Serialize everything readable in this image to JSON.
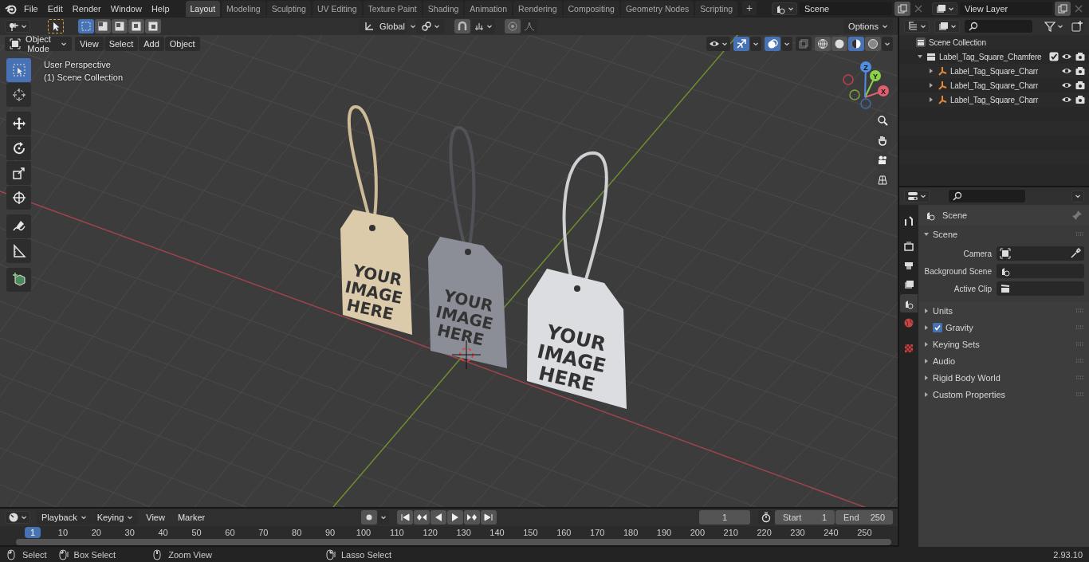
{
  "menu": [
    "File",
    "Edit",
    "Render",
    "Window",
    "Help"
  ],
  "workspaces": [
    {
      "label": "Layout",
      "selected": true
    },
    {
      "label": "Modeling",
      "selected": false
    },
    {
      "label": "Sculpting",
      "selected": false
    },
    {
      "label": "UV Editing",
      "selected": false
    },
    {
      "label": "Texture Paint",
      "selected": false
    },
    {
      "label": "Shading",
      "selected": false
    },
    {
      "label": "Animation",
      "selected": false
    },
    {
      "label": "Rendering",
      "selected": false
    },
    {
      "label": "Compositing",
      "selected": false
    },
    {
      "label": "Geometry Nodes",
      "selected": false
    },
    {
      "label": "Scripting",
      "selected": false
    }
  ],
  "add_workspace": "+",
  "scene_field": {
    "value": "Scene"
  },
  "view_layer_field": {
    "value": "View Layer"
  },
  "tool_settings": {
    "select_modes": [
      {
        "selected": true
      },
      {
        "selected": false
      },
      {
        "selected": false
      },
      {
        "selected": false
      },
      {
        "selected": false
      }
    ],
    "orientation": "Global",
    "options": "Options"
  },
  "viewport_header": {
    "mode": "Object Mode",
    "menus": [
      "View",
      "Select",
      "Add",
      "Object"
    ],
    "toggles": [
      {
        "kind": "gizmo",
        "on": true
      },
      {
        "kind": "overlay",
        "on": true
      },
      {
        "kind": "xray",
        "on": false
      }
    ],
    "shading": [
      {
        "kind": "wireframe",
        "selected": false
      },
      {
        "kind": "solid",
        "selected": false
      },
      {
        "kind": "material",
        "selected": true
      },
      {
        "kind": "rendered",
        "selected": false
      }
    ]
  },
  "toolbar": [
    {
      "kind": "select",
      "selected": true
    },
    {
      "kind": "cursor",
      "selected": false
    },
    {
      "kind": "move",
      "selected": false
    },
    {
      "kind": "rotate",
      "selected": false
    },
    {
      "kind": "scale",
      "selected": false
    },
    {
      "kind": "transform",
      "selected": false
    },
    {
      "kind": "annotate",
      "selected": false
    },
    {
      "kind": "measure",
      "selected": false
    },
    {
      "kind": "add_cube",
      "selected": false
    }
  ],
  "viewport": {
    "view_name": "User Perspective",
    "collection": "(1) Scene Collection",
    "gizmo_axes": [
      "X",
      "Y",
      "Z"
    ],
    "tags": [
      {
        "color": "#dccbaa",
        "lines": [
          "YOUR",
          "IMAGE",
          "HERE"
        ]
      },
      {
        "color": "#8b8e96",
        "lines": [
          "YOUR",
          "IMAGE",
          "HERE"
        ]
      },
      {
        "color": "#dcdde1",
        "lines": [
          "YOUR",
          "IMAGE",
          "HERE"
        ]
      }
    ]
  },
  "outliner": {
    "root": "Scene Collection",
    "children": [
      {
        "name": "Label_Tag_Square_Chamfere",
        "expanded": true,
        "checked": true,
        "children": [
          {
            "name": "Label_Tag_Square_Charr",
            "expanded": false
          },
          {
            "name": "Label_Tag_Square_Charr",
            "expanded": false
          },
          {
            "name": "Label_Tag_Square_Charr",
            "expanded": false
          }
        ]
      }
    ]
  },
  "properties": {
    "tabs": [
      {
        "kind": "tool",
        "selected": false
      },
      {
        "kind": "render",
        "selected": false
      },
      {
        "kind": "output",
        "selected": false
      },
      {
        "kind": "view_layer",
        "selected": false
      },
      {
        "kind": "scene",
        "selected": true
      },
      {
        "kind": "world",
        "selected": false
      },
      {
        "kind": "texture",
        "selected": false
      }
    ],
    "context": "Scene",
    "panel": {
      "title": "Scene",
      "expanded": true,
      "fields": [
        {
          "label": "Camera",
          "kind": "object"
        },
        {
          "label": "Background Scene",
          "kind": "scene"
        },
        {
          "label": "Active Clip",
          "kind": "clip"
        }
      ]
    },
    "sections": [
      {
        "title": "Units",
        "expanded": false
      },
      {
        "title": "Gravity",
        "expanded": false,
        "checkbox": {
          "checked": true
        }
      },
      {
        "title": "Keying Sets",
        "expanded": false
      },
      {
        "title": "Audio",
        "expanded": false
      },
      {
        "title": "Rigid Body World",
        "expanded": false
      },
      {
        "title": "Custom Properties",
        "expanded": false
      }
    ]
  },
  "timeline": {
    "menus": [
      "Playback",
      "Keying",
      "View",
      "Marker"
    ],
    "current_frame": "1",
    "start_label": "Start",
    "start": "1",
    "end_label": "End",
    "end": "250",
    "ruler": [
      {
        "label": "1",
        "selected": true
      },
      {
        "label": "10",
        "selected": false
      },
      {
        "label": "20",
        "selected": false
      },
      {
        "label": "30",
        "selected": false
      },
      {
        "label": "40",
        "selected": false
      },
      {
        "label": "50",
        "selected": false
      },
      {
        "label": "60",
        "selected": false
      },
      {
        "label": "70",
        "selected": false
      },
      {
        "label": "80",
        "selected": false
      },
      {
        "label": "90",
        "selected": false
      },
      {
        "label": "100",
        "selected": false
      },
      {
        "label": "110",
        "selected": false
      },
      {
        "label": "120",
        "selected": false
      },
      {
        "label": "130",
        "selected": false
      },
      {
        "label": "140",
        "selected": false
      },
      {
        "label": "150",
        "selected": false
      },
      {
        "label": "160",
        "selected": false
      },
      {
        "label": "170",
        "selected": false
      },
      {
        "label": "180",
        "selected": false
      },
      {
        "label": "190",
        "selected": false
      },
      {
        "label": "200",
        "selected": false
      },
      {
        "label": "210",
        "selected": false
      },
      {
        "label": "220",
        "selected": false
      },
      {
        "label": "230",
        "selected": false
      },
      {
        "label": "240",
        "selected": false
      },
      {
        "label": "250",
        "selected": false
      }
    ]
  },
  "status_bar": {
    "hints": [
      {
        "kind": "left",
        "label": "Select"
      },
      {
        "kind": "left_drag",
        "label": "Box Select"
      },
      {
        "kind": "middle",
        "label": "Zoom View"
      },
      {
        "kind": "right_drag",
        "label": "Lasso Select"
      }
    ],
    "version": "2.93.10"
  }
}
